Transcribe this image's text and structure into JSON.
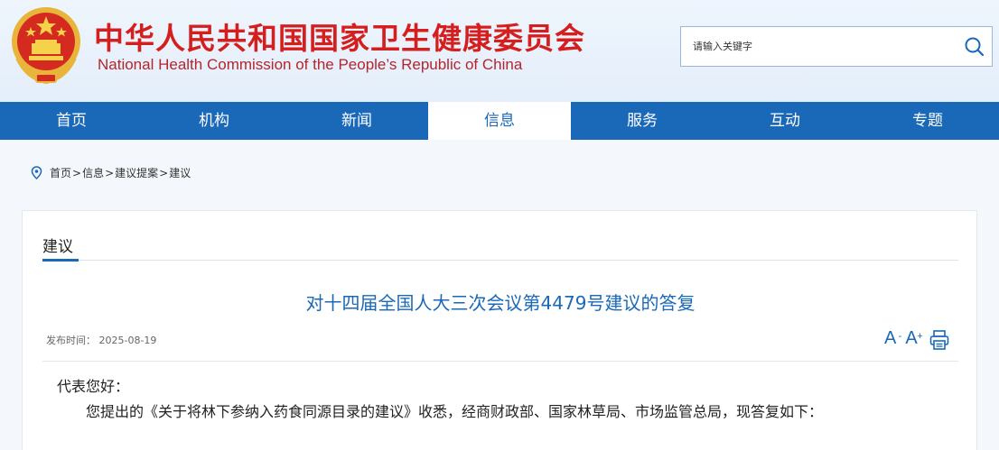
{
  "header": {
    "title_cn": "中华人民共和国国家卫生健康委员会",
    "title_en": "National Health Commission of the People’s Republic of China",
    "search_placeholder": "请输入关键字"
  },
  "nav": {
    "items": [
      "首页",
      "机构",
      "新闻",
      "信息",
      "服务",
      "互动",
      "专题"
    ],
    "active": "信息"
  },
  "breadcrumb": [
    "首页",
    "信息",
    "建议提案",
    "建议"
  ],
  "breadcrumb_sep": ">",
  "section": {
    "title": "建议"
  },
  "article": {
    "title": "对十四届全国人大三次会议第4479号建议的答复",
    "publish_label": "发布时间：",
    "publish_date": "2025-08-19",
    "greeting": "代表您好：",
    "paragraph": "您提出的《关于将林下参纳入药食同源目录的建议》收悉，经商财政部、国家林草局、市场监管总局，现答复如下："
  },
  "tools": {
    "font_decrease": "A",
    "font_decrease_sup": "-",
    "font_increase": "A",
    "font_increase_sup": "+"
  },
  "colors": {
    "brand_blue": "#1a68b8",
    "title_red": "#d51f1f"
  }
}
